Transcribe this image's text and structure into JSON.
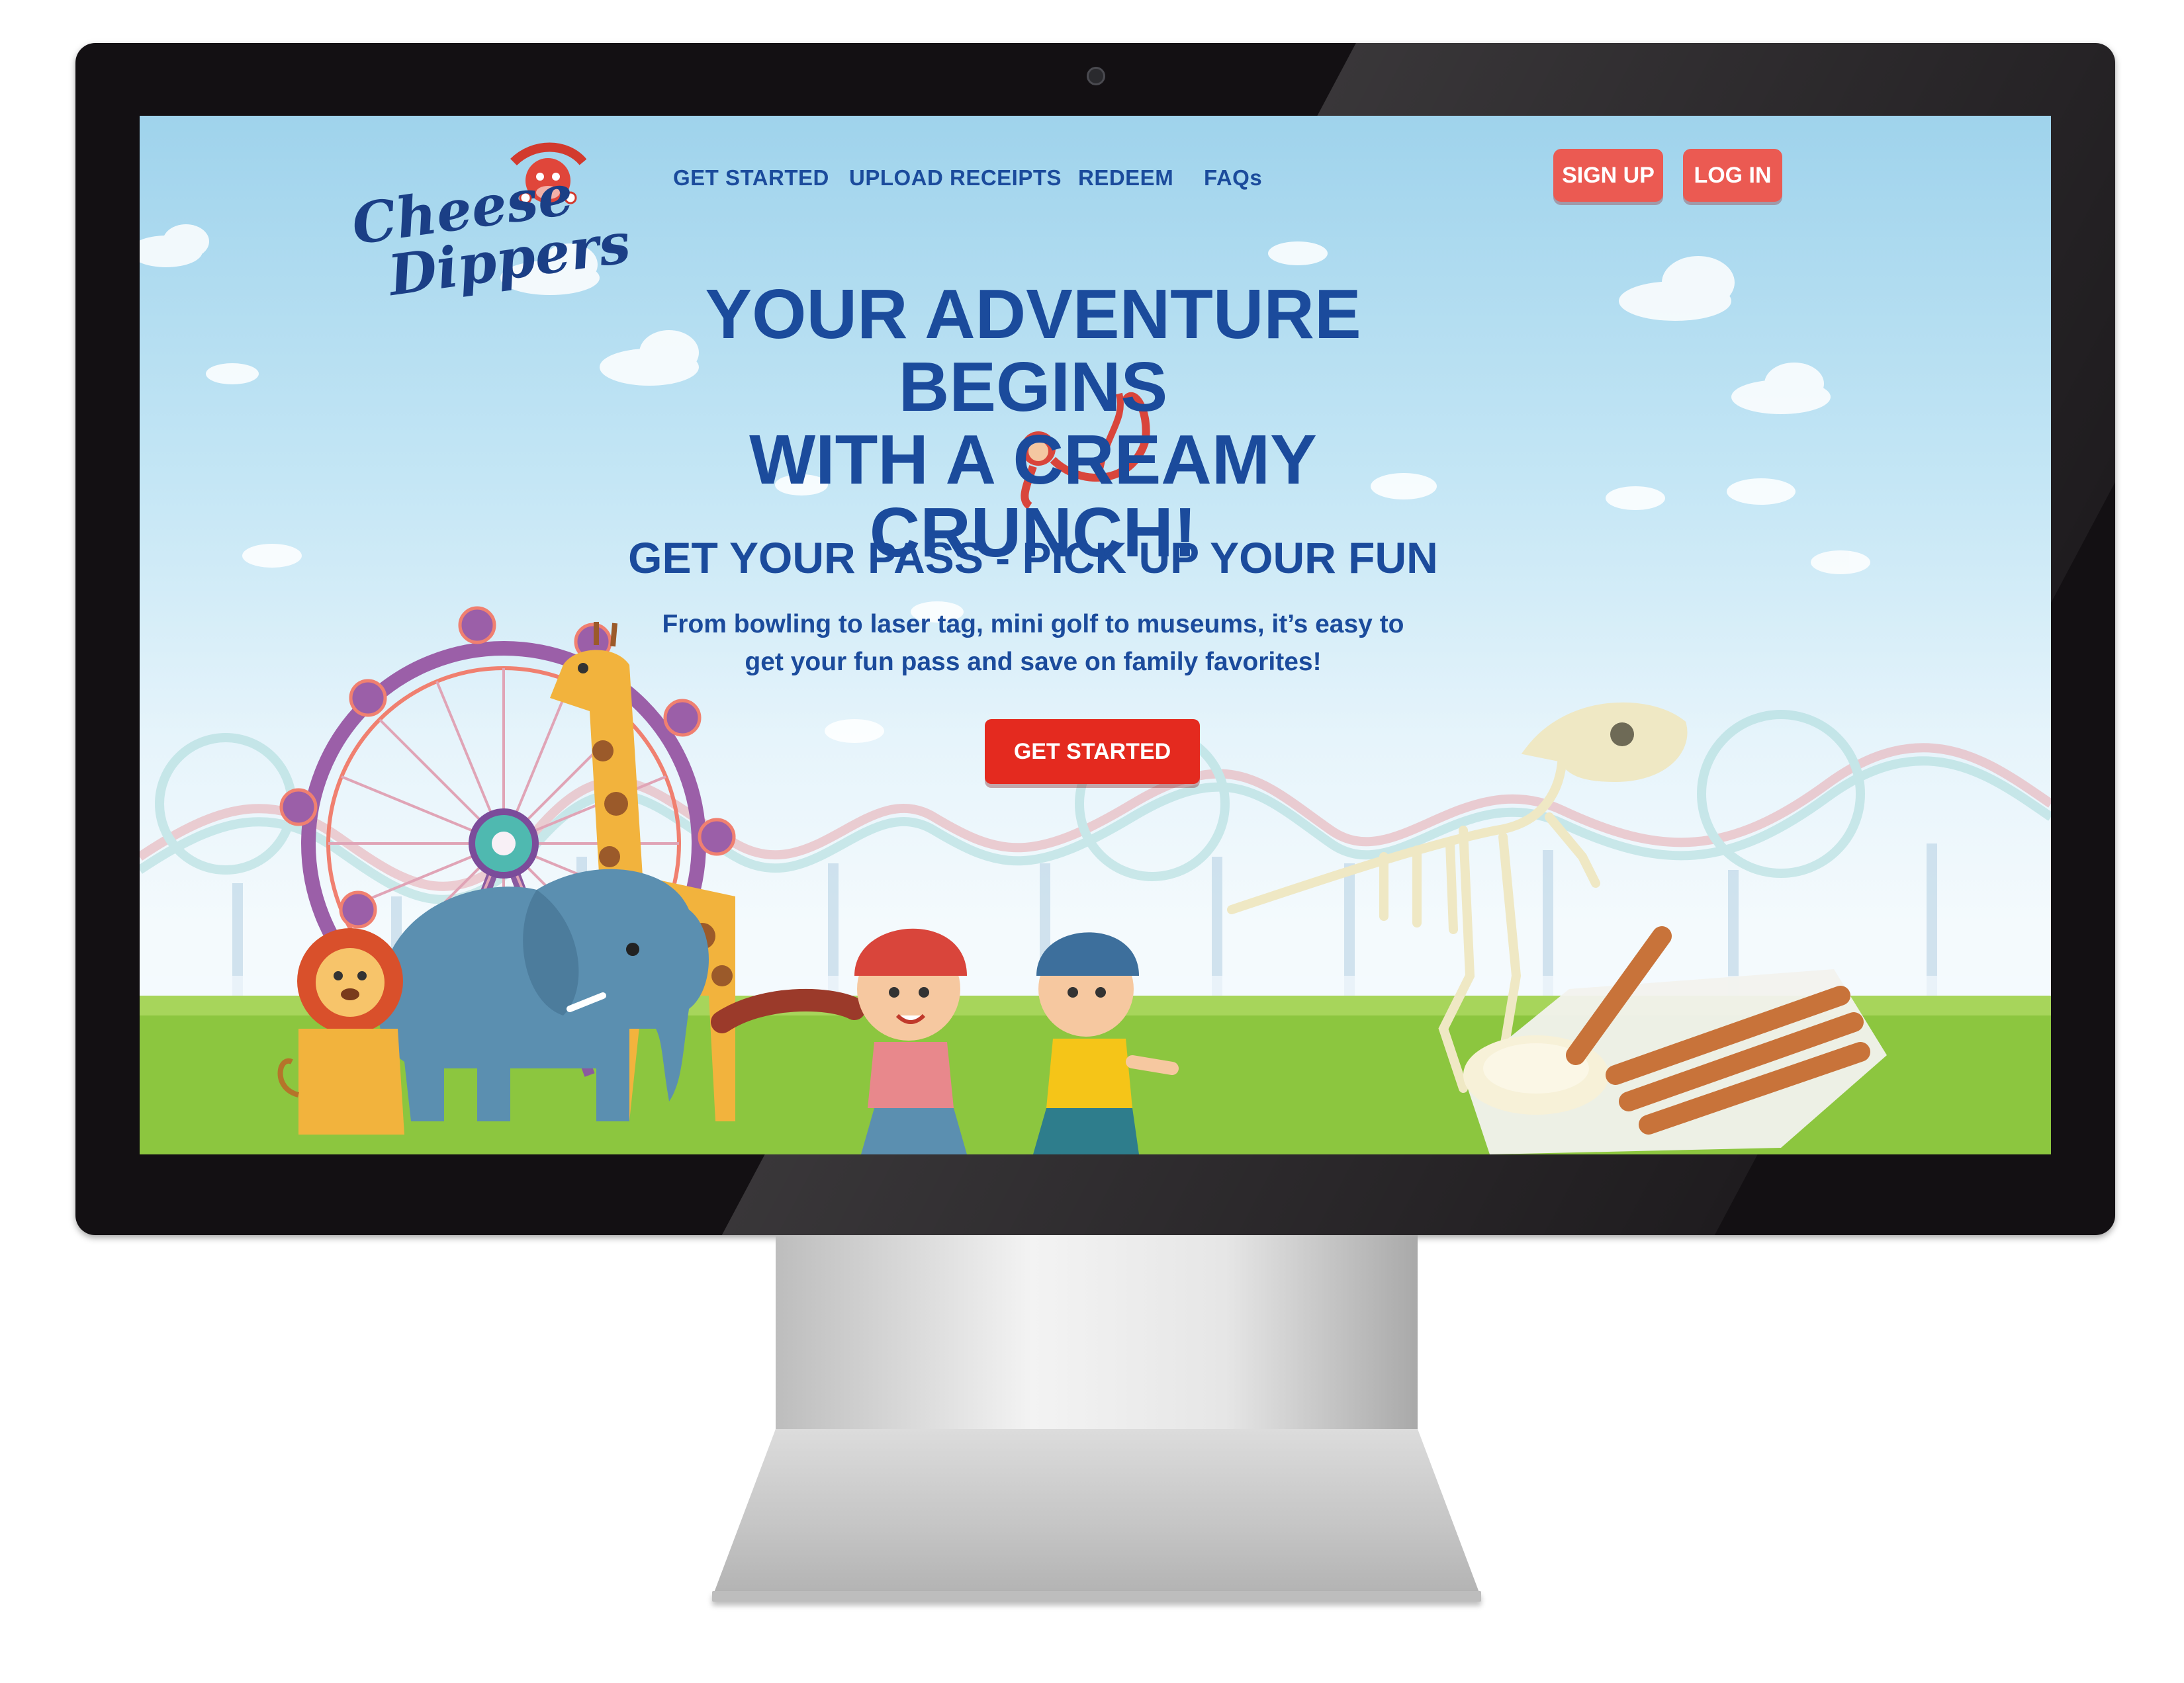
{
  "site": {
    "logo": {
      "line1": "Cheese",
      "line2": "Dippers",
      "badge": "The Laughing Cow"
    },
    "nav": [
      {
        "label": "GET STARTED"
      },
      {
        "label": "UPLOAD RECEIPTS"
      },
      {
        "label": "REDEEM"
      },
      {
        "label": "FAQs"
      }
    ],
    "signup_label": "SIGN UP",
    "login_label": "LOG IN"
  },
  "hero": {
    "headline_line1": "YOUR ADVENTURE BEGINS",
    "headline_line2": "WITH A CREAMY CRUNCH!",
    "subhead": "GET YOUR PASS - PICK UP YOUR FUN",
    "description": "From bowling to laser tag, mini golf to museums, it’s easy to get your fun pass and save on family favorites!",
    "cta_label": "GET STARTED"
  },
  "colors": {
    "brand_blue": "#1b4b9c",
    "button_coral": "#eb5a52",
    "cta_red": "#e42a1f",
    "sky": "#bde3f4",
    "grass": "#8cc63f"
  },
  "icons": {
    "camera": "webcam-icon",
    "mascot": "cow-mascot-icon"
  }
}
